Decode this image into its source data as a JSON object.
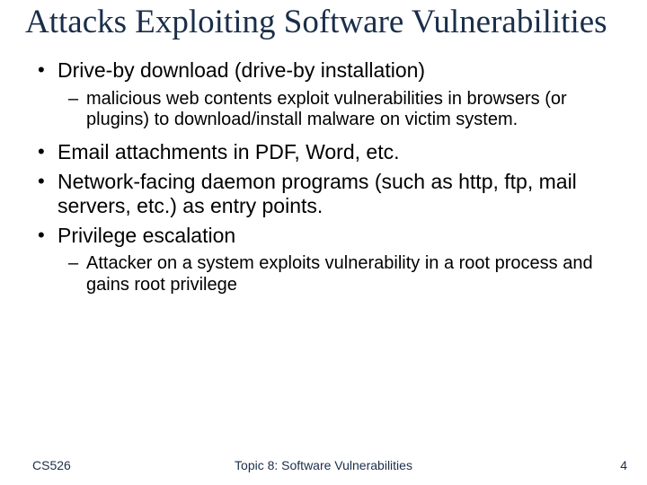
{
  "title": "Attacks Exploiting Software Vulnerabilities",
  "bullets": {
    "b0": "Drive-by download (drive-by installation)",
    "b0_sub0": "malicious web contents exploit vulnerabilities in browsers (or plugins) to download/install malware on victim system.",
    "b1": "Email attachments in PDF, Word, etc.",
    "b2": "Network-facing daemon programs (such as http, ftp, mail servers, etc.) as entry points.",
    "b3": "Privilege escalation",
    "b3_sub0": "Attacker on a system exploits vulnerability in a root process and gains root privilege"
  },
  "footer": {
    "left": "CS526",
    "center": "Topic 8: Software Vulnerabilities",
    "right": "4"
  }
}
